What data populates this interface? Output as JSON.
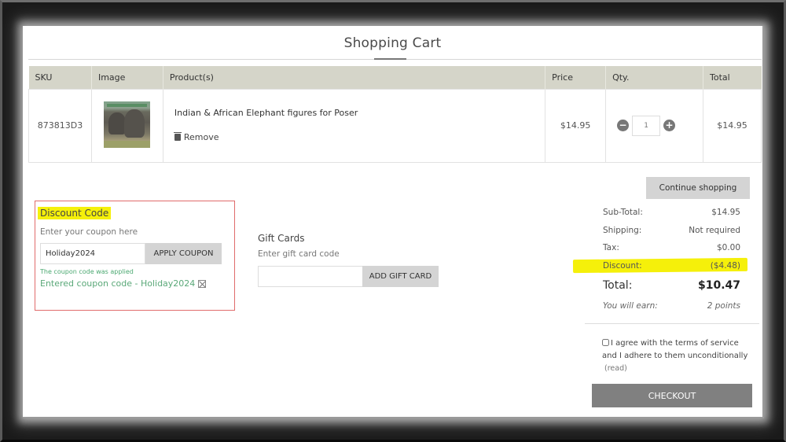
{
  "header": {
    "title": "Shopping Cart"
  },
  "table": {
    "columns": [
      "SKU",
      "Image",
      "Product(s)",
      "Price",
      "Qty.",
      "Total"
    ],
    "rows": [
      {
        "sku": "873813D3",
        "image": "elephant-product-thumbnail",
        "product": "Indian & African Elephant figures for Poser",
        "remove_label": "Remove",
        "price": "$14.95",
        "qty": "1",
        "total": "$14.95"
      }
    ]
  },
  "discount": {
    "title": "Discount Code",
    "hint": "Enter your coupon here",
    "input_value": "Holiday2024",
    "apply_label": "APPLY COUPON",
    "applied_message": "The coupon code was applied",
    "entered_code": "Entered coupon code - Holiday2024"
  },
  "gift": {
    "title": "Gift Cards",
    "hint": "Enter gift card code",
    "input_value": "",
    "add_label": "ADD GIFT CARD"
  },
  "summary": {
    "continue_label": "Continue shopping",
    "subtotal_label": "Sub-Total:",
    "subtotal": "$14.95",
    "shipping_label": "Shipping:",
    "shipping": "Not required",
    "tax_label": "Tax:",
    "tax": "$0.00",
    "discount_label": "Discount:",
    "discount": "($4.48)",
    "total_label": "Total:",
    "total": "$10.47",
    "earn_label": "You will earn:",
    "earn": "2 points"
  },
  "terms": {
    "checked": false,
    "text": "I agree with the terms of service and I adhere to them unconditionally",
    "read_label": "(read)"
  },
  "checkout": {
    "label": "CHECKOUT"
  },
  "colors": {
    "highlight": "#f5f00a",
    "header_bg": "#d5d5c9",
    "success_green": "#4aa870",
    "discount_box_border": "#e06b6b",
    "checkout_bg": "#808080"
  }
}
